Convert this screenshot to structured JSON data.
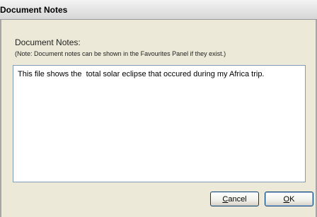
{
  "window": {
    "title": "Document Notes"
  },
  "form": {
    "notes_label": "Document Notes:",
    "hint": "(Note: Document notes can be shown in the Favourites Panel if they exist.)",
    "notes_value": "This file shows the  total solar eclipse that occured during my Africa trip."
  },
  "buttons": {
    "cancel_label": "Cancel",
    "ok_label": "OK"
  },
  "colors": {
    "dialog_background": "#ece9d8",
    "button_border": "#003c74",
    "textarea_border": "#7f9db9"
  }
}
